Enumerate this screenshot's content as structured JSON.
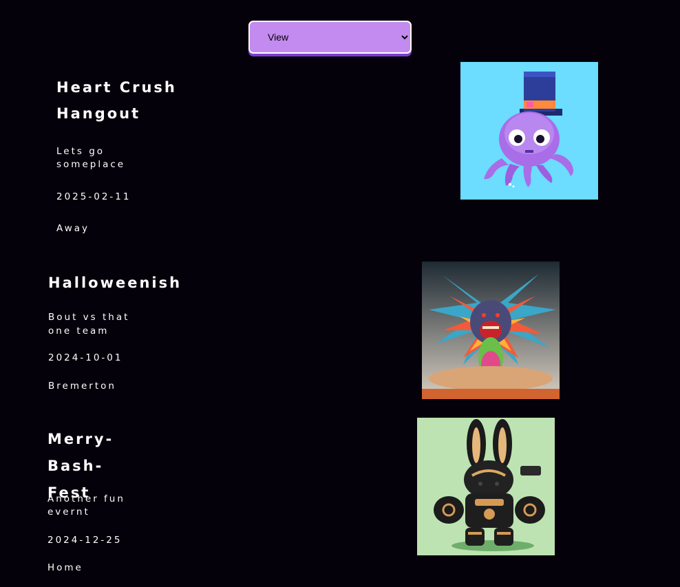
{
  "view_select": {
    "selected": "View"
  },
  "events": [
    {
      "title": "Heart Crush Hangout",
      "description": "Lets go someplace",
      "date": "2025-02-11",
      "location": "Away",
      "image_icon": "octopus-top-hat-image"
    },
    {
      "title": "Halloweenish",
      "description": "Bout vs that one team",
      "date": "2024-10-01",
      "location": "Bremerton",
      "image_icon": "color-explosion-monster-image"
    },
    {
      "title": "Merry-Bash-Fest",
      "description": "Another fun evernt",
      "date": "2024-12-25",
      "location": "Home",
      "image_icon": "robot-bunny-image"
    }
  ],
  "colors": {
    "background": "#05010a",
    "select_bg": "#c38bef",
    "select_shadow": "#7b3fd0"
  }
}
